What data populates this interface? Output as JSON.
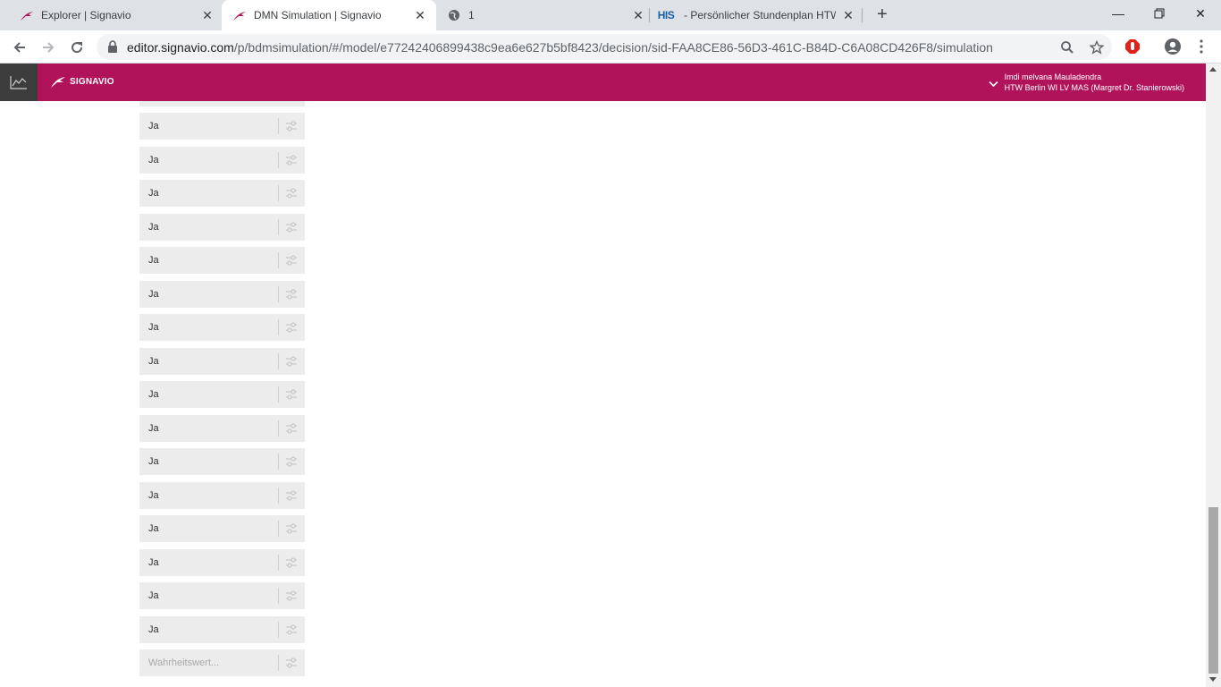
{
  "browser": {
    "tabs": [
      {
        "title": "Explorer | Signavio",
        "favicon": "signavio-icon",
        "active": false
      },
      {
        "title": "DMN Simulation | Signavio",
        "favicon": "signavio-icon",
        "active": true
      },
      {
        "title": "1",
        "favicon": "globe-icon",
        "active": false
      },
      {
        "title": "- Persönlicher Stundenplan HTW",
        "favicon": "his-icon",
        "favicon_text": "HIS",
        "active": false
      }
    ],
    "url_host": "editor.signavio.com",
    "url_path": "/p/bdmsimulation/#/model/e77242406899438c9ea6e627b5bf8423/decision/sid-FAA8CE86-56D3-461C-B84D-C6A08CD426F8/simulation"
  },
  "app": {
    "brand": "SIGNAVIO",
    "user_name": "Imdi melvana Mauladendra",
    "user_org": "HTW Berlin WI LV MAS (Margret Dr. Stanierowski)",
    "accent_color": "#b0135a"
  },
  "fields": {
    "values": [
      "Ja",
      "Ja",
      "Ja",
      "Ja",
      "Ja",
      "Ja",
      "Ja",
      "Ja",
      "Ja",
      "Ja",
      "Ja",
      "Ja",
      "Ja",
      "Ja",
      "Ja",
      "Ja"
    ],
    "placeholder": "Wahrheitswert..."
  }
}
